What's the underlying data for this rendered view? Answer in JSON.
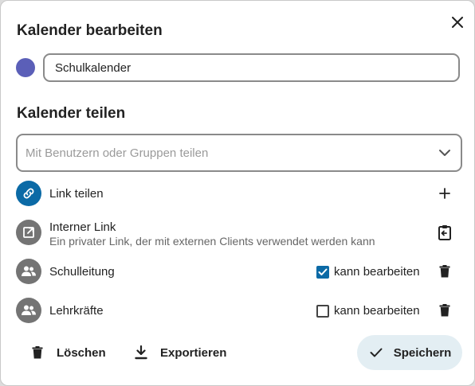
{
  "dialog": {
    "title": "Kalender bearbeiten",
    "close_icon": "close-icon"
  },
  "calendar": {
    "color": "#5b5fb8",
    "name_value": "Schulkalender"
  },
  "sharing": {
    "title": "Kalender teilen",
    "search_placeholder": "Mit Benutzern oder Gruppen teilen",
    "link_share": {
      "label": "Link teilen",
      "icon": "link-icon",
      "action_icon": "plus-icon"
    },
    "internal_link": {
      "title": "Interner Link",
      "subtitle": "Ein privater Link, der mit externen Clients verwendet werden kann",
      "icon": "open-in-new-icon",
      "action_icon": "clipboard-icon"
    },
    "shares": [
      {
        "name": "Schulleitung",
        "can_edit": true,
        "permission_label": "kann bearbeiten",
        "icon": "group-icon",
        "action_icon": "delete-icon"
      },
      {
        "name": "Lehrkräfte",
        "can_edit": false,
        "permission_label": "kann bearbeiten",
        "icon": "group-icon",
        "action_icon": "delete-icon"
      }
    ]
  },
  "footer": {
    "delete_label": "Löschen",
    "export_label": "Exportieren",
    "save_label": "Speichern"
  },
  "colors": {
    "accent": "#0b6aa6",
    "save_button_bg": "#e3eef3",
    "group_icon_bg": "#747474"
  }
}
